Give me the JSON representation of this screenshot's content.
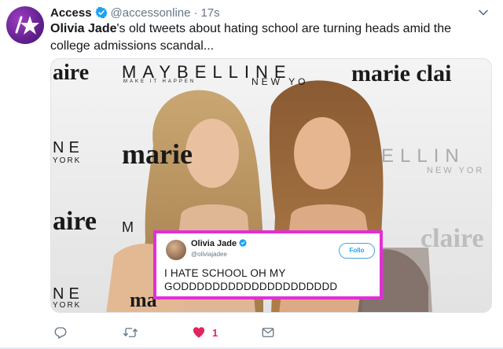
{
  "tweet": {
    "author_name": "Access",
    "handle": "@accessonline",
    "separator": "·",
    "time": "17s",
    "text_highlight": "Olivia Jade",
    "text_rest": "'s old tweets about hating school are turning heads amid the college admissions scandal..."
  },
  "media": {
    "backdrop_logos": {
      "maybelline": "MAYBELLINE",
      "maybelline_tagline": "MAKE IT HAPPEN",
      "new_york": "NEW YO",
      "new_york_right": "NEW YOR",
      "elline": "ELLIN",
      "marie_claire_top": "marie clai",
      "aire_top": "aire",
      "aire_mid": "aire",
      "marie_mid": "marie",
      "claire_right": "claire",
      "ne_mid": "NE",
      "york_mid": "YORK",
      "ne_bottom": "NE",
      "york_bottom": "YORK",
      "m_mid": "M",
      "ma_bottom": "ma"
    },
    "embedded_tweet": {
      "name": "Olivia Jade",
      "handle": "@oliviajadee",
      "follow_label": "Follo",
      "line1": "I HATE SCHOOL OH MY",
      "line2": "GODDDDDDDDDDDDDDDDDDDD"
    }
  },
  "actions": {
    "reply_icon": "reply-icon",
    "retweet_icon": "retweet-icon",
    "like_icon": "heart-icon",
    "like_count": "1",
    "dm_icon": "envelope-icon"
  },
  "colors": {
    "verified_blue": "#1da1f2",
    "like_red": "#e0245e",
    "highlight_border": "#e22fd6",
    "avatar_purple": "#6b25a0"
  }
}
